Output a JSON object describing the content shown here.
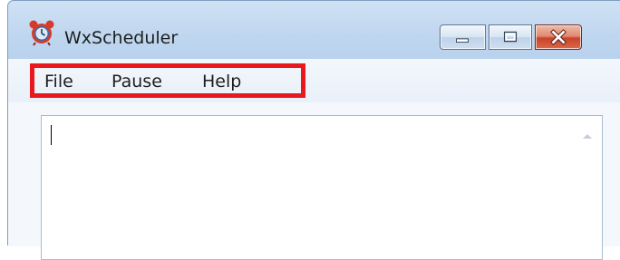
{
  "window": {
    "title": "WxScheduler",
    "icon": "alarm-clock-icon"
  },
  "caption_buttons": {
    "minimize_icon": "minimize-icon",
    "maximize_icon": "maximize-icon",
    "close_icon": "close-icon"
  },
  "menubar": {
    "items": [
      {
        "label": "File"
      },
      {
        "label": "Pause"
      },
      {
        "label": "Help"
      }
    ],
    "highlight_color": "#e8181e"
  },
  "editor": {
    "value": ""
  },
  "colors": {
    "close_button": "#c9432a",
    "frame": "#bfd6ef"
  }
}
